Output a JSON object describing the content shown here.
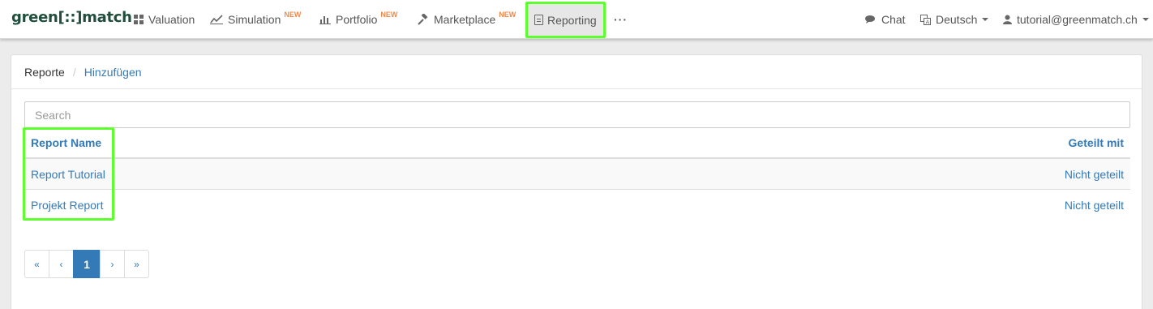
{
  "navbar": {
    "logo": "green[::]match",
    "items": [
      {
        "label": "Valuation",
        "icon": "grid-icon",
        "badge": ""
      },
      {
        "label": "Simulation",
        "icon": "chart-line-icon",
        "badge": "NEW"
      },
      {
        "label": "Portfolio",
        "icon": "bar-chart-icon",
        "badge": "NEW"
      },
      {
        "label": "Marketplace",
        "icon": "gavel-icon",
        "badge": "NEW"
      },
      {
        "label": "Reporting",
        "icon": "document-icon",
        "badge": ""
      }
    ],
    "more": "···",
    "chat": "Chat",
    "language": "Deutsch",
    "user": "tutorial@greenmatch.ch"
  },
  "breadcrumb": {
    "current": "Reporte",
    "separator": "/",
    "link": "Hinzufügen"
  },
  "search": {
    "placeholder": "Search",
    "value": ""
  },
  "table": {
    "columns": [
      "Report Name",
      "Geteilt mit"
    ],
    "rows": [
      {
        "name": "Report Tutorial",
        "shared": "Nicht geteilt"
      },
      {
        "name": "Projekt Report",
        "shared": "Nicht geteilt"
      }
    ]
  },
  "pagination": {
    "first": "«",
    "prev": "‹",
    "current": "1",
    "next": "›",
    "last": "»"
  },
  "colors": {
    "highlight": "#5eff2f",
    "link": "#337ab7",
    "badge": "#f0894a",
    "logo": "#1f4e3d"
  }
}
